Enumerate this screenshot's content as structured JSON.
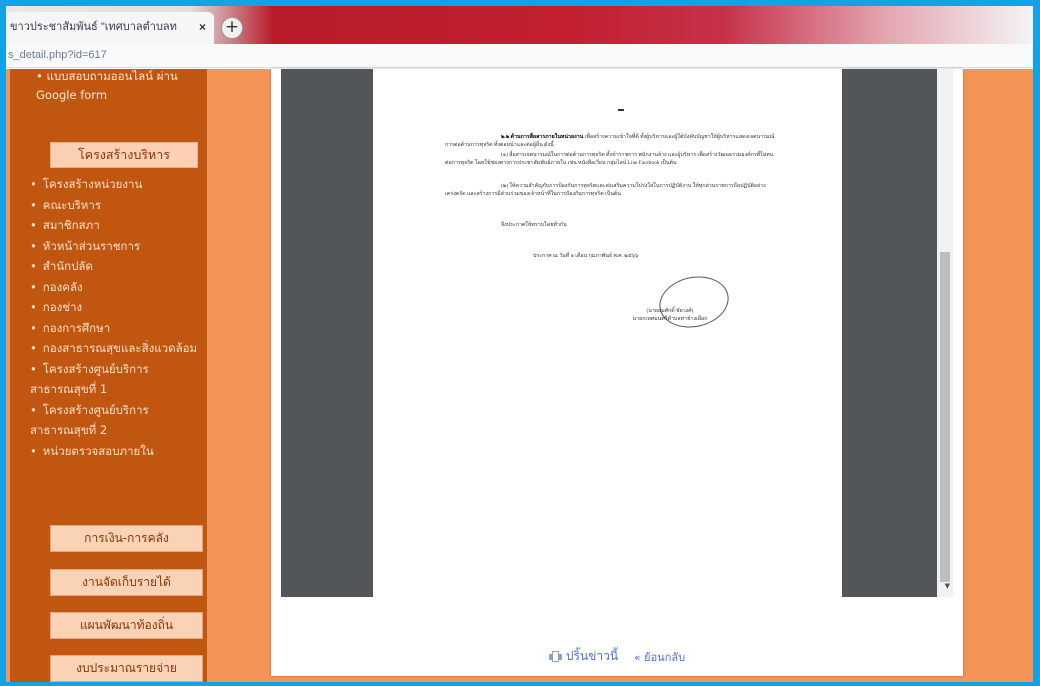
{
  "browser": {
    "tab_title": "ขาวประชาสัมพันธ์ \"เทศบาลตำบลท",
    "tab_close": "×",
    "new_tab": "+",
    "address": "s_detail.php?id=617"
  },
  "sidebar": {
    "top_text": "• แบบสอบถามออนไลน์ ผ่าน Google form",
    "heading": "โครงสร้างบริหาร",
    "items": [
      "โครงสร้างหน่วยงาน",
      "คณะบริหาร",
      "สมาชิกสภา",
      "หัวหน้าส่วนราชการ",
      "สำนักปลัด",
      "กองคลัง",
      "กองช่าง",
      "กองการศึกษา",
      "กองสาธารณสุขและสิ่งแวดล้อม",
      "โครงสร้างศูนย์บริการสาธารณสุขที่ 1",
      "โครงสร้างศูนย์บริการสาธารณสุขที่ 2",
      "หน่วยตรวจสอบภายใน"
    ],
    "buttons": [
      "การเงิน-การคลัง",
      "งานจัดเก็บรายได้",
      "แผนพัฒนาท้องถิ่น",
      "งบประมาณรายจ่าย"
    ]
  },
  "document": {
    "mark": "-",
    "para1_bold": "๒.๒ ด้านการสื่อสารภายในหน่วยงาน",
    "para1": "เพื่อสร้างความเข้าใจที่ดี ทั้งผู้บริหารและผู้ใต้บังคับบัญชาให้ผู้บริหารแสดงเจตนารมณ์การต่อต้านการทุจริต ทั้งต่อหน้าและต่อผู้อื่น ดังนี้",
    "para2": "(๑) สื่อสารเจตนารมณ์ในการต่อต้านการทุจริต ทั้งข้าราชการ พนักงานจ้าง และผู้บริหาร เพื่อสร้างวัฒนธรรมองค์กรที่ไม่ทนต่อการทุจริต โดยใช้ช่องทางการประชาสัมพันธ์ภายใน เช่น หนังสือเวียน กลุ่มไลน์ Line Facebook เป็นต้น",
    "para3": "(๒) ให้ความสำคัญกับการป้องกันการทุจริตและส่งเสริมความโปร่งใสในการปฏิบัติงาน ให้ทุกส่วนราชการถือปฏิบัติอย่างเคร่งครัด และสร้างการมีส่วนร่วมของเจ้าหน้าที่ในการป้องกันการทุจริต เป็นต้น",
    "para4": "จึงประกาศให้ทราบโดยทั่วกัน",
    "date_line": "ประกาศ ณ วันที่ ๑ เดือน กุมภาพันธ์ พ.ศ. ๒๕๖๖",
    "signer_name": "(นายสมศักดิ์ ชัยวงศ์)",
    "signer_title": "นายกเทศมนตรีตำบลท่าช้างเผือก"
  },
  "actions": {
    "print": "ปริ้นข่าวนี้",
    "back": "« ย้อนกลับ"
  }
}
